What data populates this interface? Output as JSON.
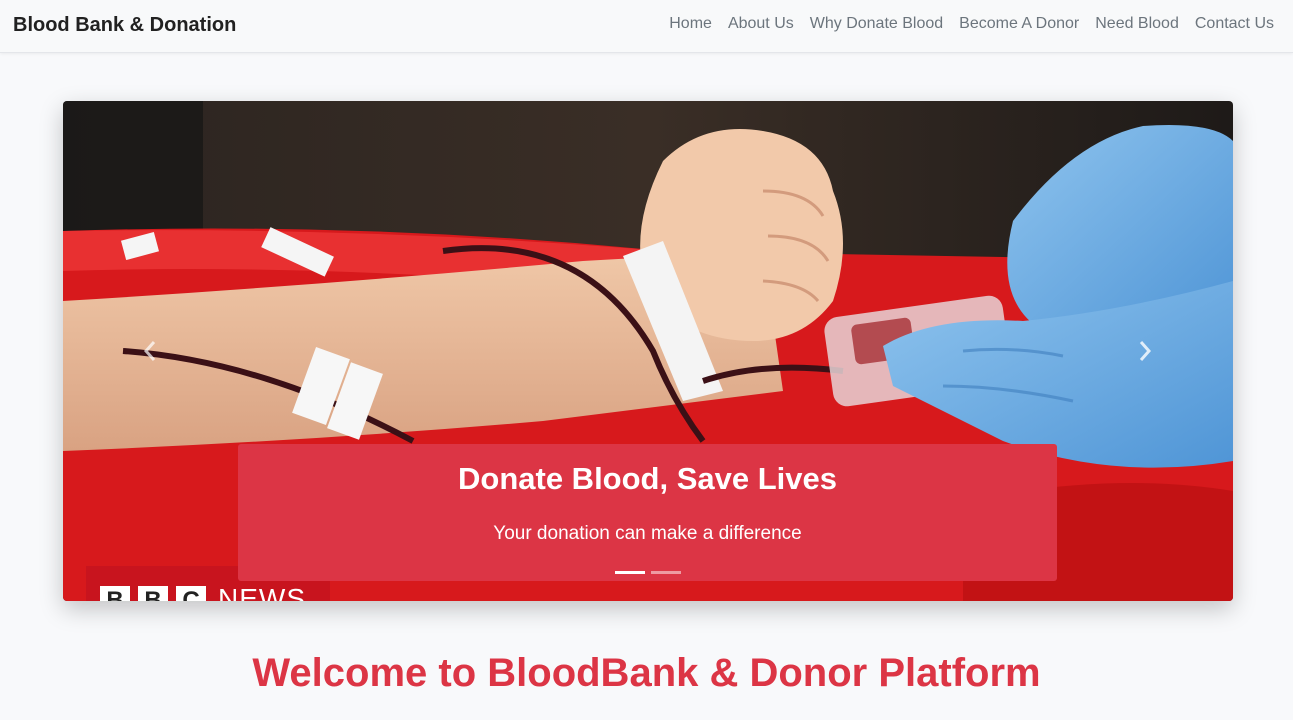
{
  "navbar": {
    "brand": "Blood Bank & Donation",
    "links": [
      {
        "label": "Home"
      },
      {
        "label": "About Us"
      },
      {
        "label": "Why Donate Blood"
      },
      {
        "label": "Become A Donor"
      },
      {
        "label": "Need Blood"
      },
      {
        "label": "Contact Us"
      }
    ]
  },
  "carousel": {
    "caption_title": "Donate Blood, Save Lives",
    "caption_text": "Your donation can make a difference",
    "slide_count": 2,
    "active_slide": 1,
    "prev_icon": "chevron-left-icon",
    "next_icon": "chevron-right-icon",
    "watermark": {
      "letters": [
        "B",
        "B",
        "C"
      ],
      "word": "NEWS"
    }
  },
  "welcome": {
    "heading": "Welcome to BloodBank & Donor Platform"
  },
  "colors": {
    "accent": "#dc3545",
    "navbar_bg": "#f8f9fa",
    "nav_link": "#6c757d",
    "page_bg": "#f8f9fb"
  }
}
